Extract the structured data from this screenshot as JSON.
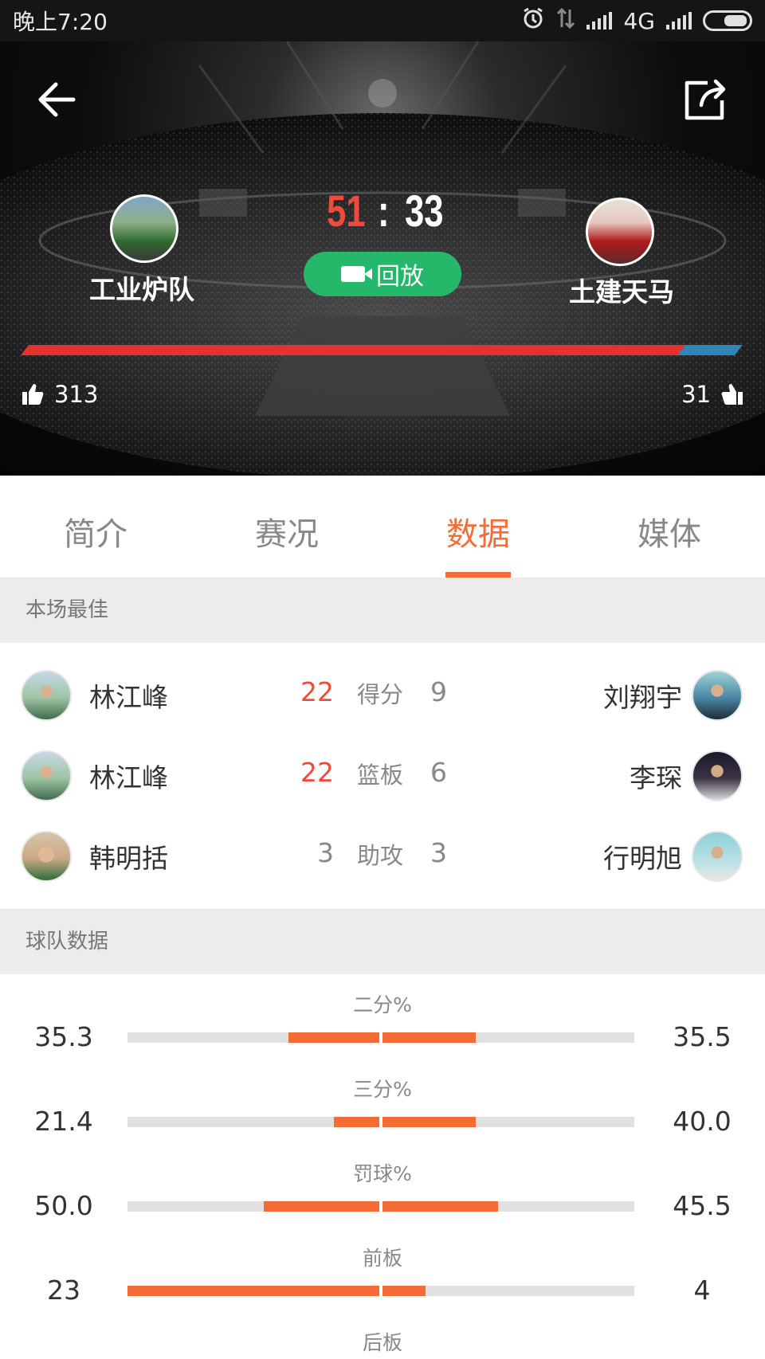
{
  "status_bar": {
    "time": "晚上7:20",
    "network": "4G"
  },
  "header": {
    "home": {
      "name": "工业炉队",
      "score": "51",
      "likes": "313"
    },
    "away": {
      "name": "土建天马",
      "score": "33",
      "likes": "31"
    },
    "score_separator": ":",
    "replay_label": "回放",
    "power_ratio": 0.92
  },
  "tabs": [
    {
      "label": "简介",
      "active": false
    },
    {
      "label": "赛况",
      "active": false
    },
    {
      "label": "数据",
      "active": true
    },
    {
      "label": "媒体",
      "active": false
    }
  ],
  "best": {
    "title": "本场最佳",
    "rows": [
      {
        "left_name": "林江峰",
        "left_value": "22",
        "category": "得分",
        "right_value": "9",
        "right_name": "刘翔宇"
      },
      {
        "left_name": "林江峰",
        "left_value": "22",
        "category": "篮板",
        "right_value": "6",
        "right_name": "李琛"
      },
      {
        "left_name": "韩明括",
        "left_value": "3",
        "category": "助攻",
        "right_value": "3",
        "right_name": "行明旭"
      }
    ]
  },
  "team_stats": {
    "title": "球队数据",
    "rows": [
      {
        "label": "二分%",
        "left": "35.3",
        "right": "35.5",
        "left_ratio": 0.36,
        "right_ratio": 0.37
      },
      {
        "label": "三分%",
        "left": "21.4",
        "right": "40.0",
        "left_ratio": 0.18,
        "right_ratio": 0.37
      },
      {
        "label": "罚球%",
        "left": "50.0",
        "right": "45.5",
        "left_ratio": 0.46,
        "right_ratio": 0.46
      },
      {
        "label": "前板",
        "left": "23",
        "right": "4",
        "left_ratio": 1.0,
        "right_ratio": 0.17
      },
      {
        "label": "后板"
      }
    ]
  },
  "colors": {
    "accent": "#f26d3a",
    "home_score": "#f04a3c",
    "replay_green": "#25b86a",
    "power_home": "#e8312f",
    "power_away": "#2f86b4",
    "stat_bar": "#f56b35"
  }
}
